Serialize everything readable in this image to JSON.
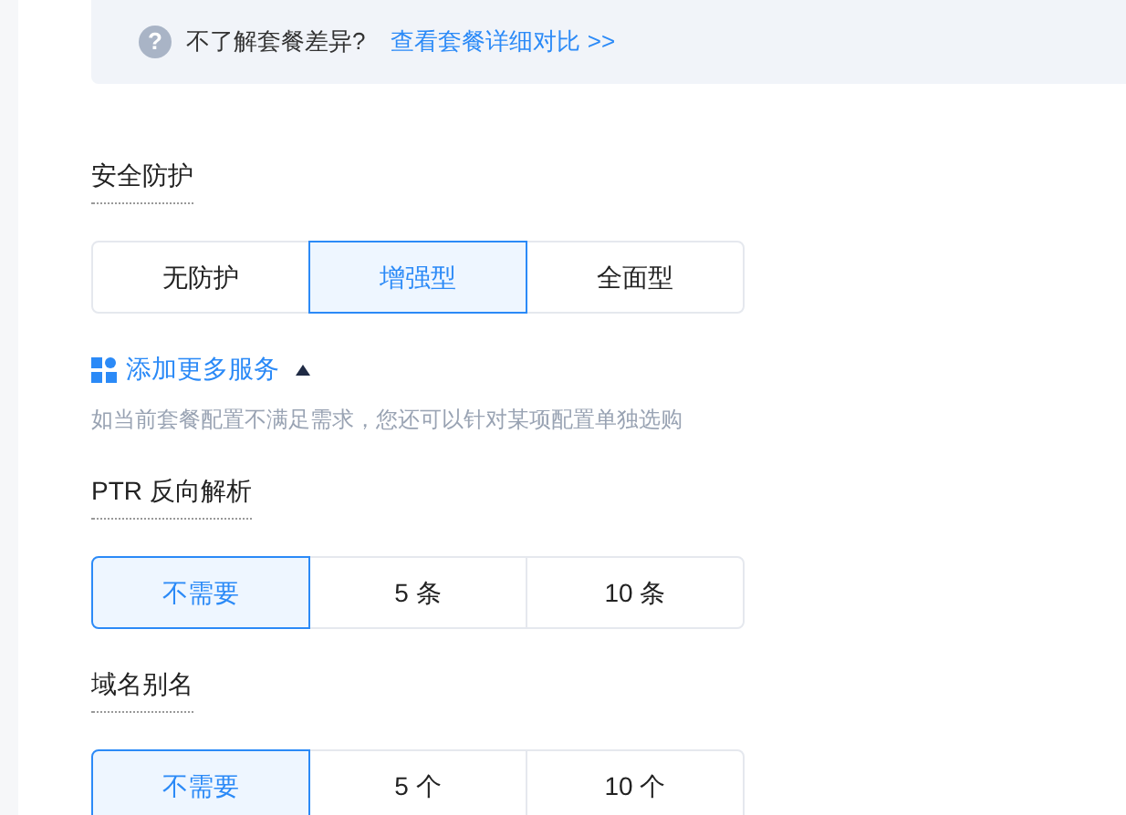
{
  "notice": {
    "icon": "?",
    "text": "不了解套餐差异?",
    "link": "查看套餐详细对比 >>"
  },
  "protection": {
    "label": "安全防护",
    "options": [
      {
        "label": "无防护",
        "selected": false
      },
      {
        "label": "增强型",
        "selected": true
      },
      {
        "label": "全面型",
        "selected": false
      }
    ]
  },
  "add_services": {
    "label": "添加更多服务",
    "expanded": true,
    "hint": "如当前套餐配置不满足需求，您还可以针对某项配置单独选购",
    "sections": [
      {
        "label": "PTR 反向解析",
        "options": [
          {
            "label": "不需要",
            "selected": true
          },
          {
            "label": "5 条",
            "selected": false
          },
          {
            "label": "10 条",
            "selected": false
          }
        ]
      },
      {
        "label": "域名别名",
        "options": [
          {
            "label": "不需要",
            "selected": true
          },
          {
            "label": "5 个",
            "selected": false
          },
          {
            "label": "10 个",
            "selected": false
          }
        ]
      }
    ]
  }
}
